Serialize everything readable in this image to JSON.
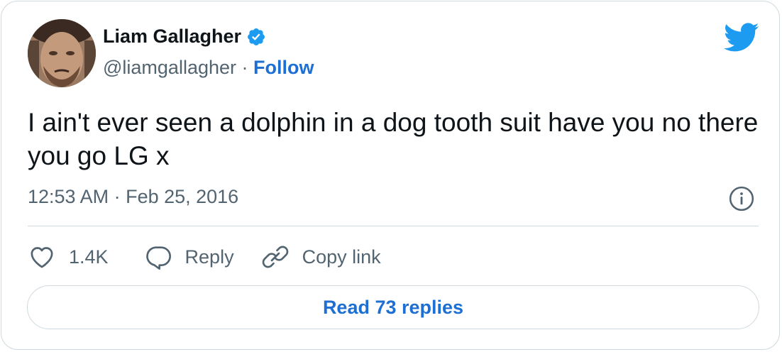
{
  "author": {
    "name": "Liam Gallagher",
    "handle": "@liamgallagher",
    "separator": "·",
    "follow_label": "Follow",
    "verified_color": "#1d9bf0"
  },
  "tweet": {
    "text": "I ain't ever seen a dolphin in a dog tooth suit have you no there you go LG x",
    "timestamp": "12:53 AM · Feb 25, 2016"
  },
  "actions": {
    "likes_count": "1.4K",
    "reply_label": "Reply",
    "copy_link_label": "Copy link"
  },
  "read_replies_label": "Read 73 replies",
  "icons": [
    "twitter-bird-icon",
    "verified-badge-icon",
    "info-icon",
    "heart-icon",
    "reply-bubble-icon",
    "link-icon"
  ],
  "colors": {
    "accent": "#1d6fd4",
    "bird": "#1d9bf0",
    "text": "#0f1419",
    "secondary_text": "#536471",
    "border": "#cfd9de"
  }
}
